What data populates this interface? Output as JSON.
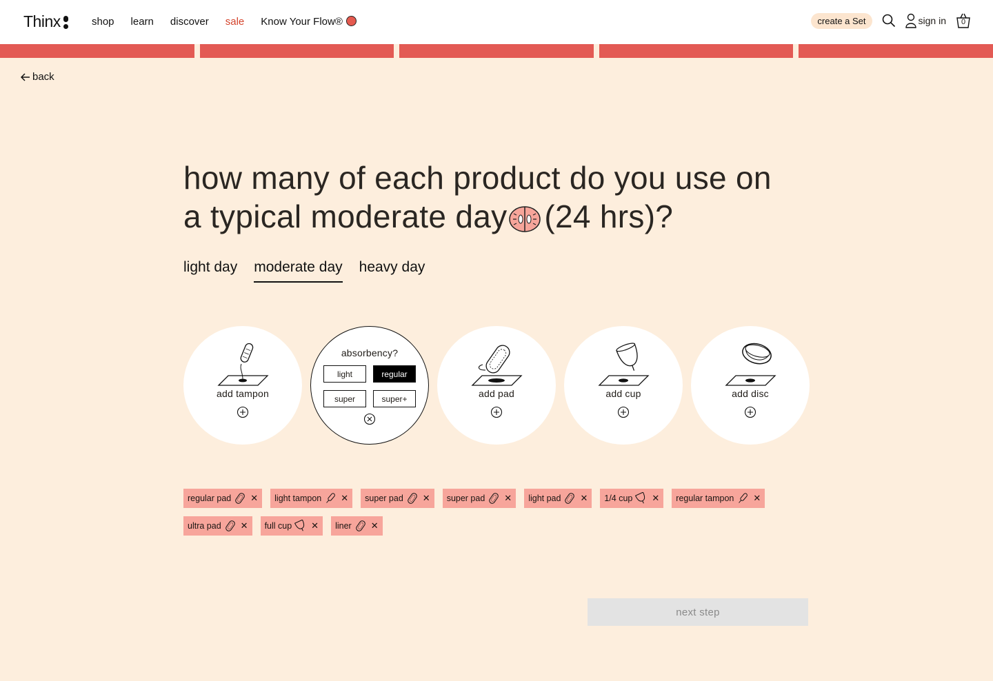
{
  "header": {
    "brand": "Thinx",
    "nav": [
      "shop",
      "learn",
      "discover",
      "sale",
      "Know Your Flow®"
    ],
    "create_set": "create a Set",
    "sign_in": "sign in",
    "cart_count": "0"
  },
  "progress": {
    "steps": 5
  },
  "back_label": "back",
  "question": {
    "line1": "how many of each product do you use on",
    "line2_a": "a typical moderate day",
    "line2_b": "(24 hrs)?"
  },
  "tabs": [
    {
      "label": "light day",
      "active": false
    },
    {
      "label": "moderate day",
      "active": true
    },
    {
      "label": "heavy day",
      "active": false
    }
  ],
  "products": [
    {
      "label": "add tampon",
      "icon": "tampon-icon"
    },
    {
      "label": "absorbency?",
      "options": [
        "light",
        "regular",
        "super",
        "super+"
      ],
      "selected": "regular"
    },
    {
      "label": "add pad",
      "icon": "pad-icon"
    },
    {
      "label": "add cup",
      "icon": "cup-icon"
    },
    {
      "label": "add disc",
      "icon": "disc-icon"
    }
  ],
  "chips": [
    {
      "label": "regular pad",
      "icon": "pad-icon"
    },
    {
      "label": "light tampon",
      "icon": "tampon-icon"
    },
    {
      "label": "super pad",
      "icon": "pad-icon"
    },
    {
      "label": "super pad",
      "icon": "pad-icon"
    },
    {
      "label": "light pad",
      "icon": "pad-icon"
    },
    {
      "label": "1/4 cup",
      "icon": "cup-icon"
    },
    {
      "label": "regular tampon",
      "icon": "tampon-icon"
    },
    {
      "label": "ultra pad",
      "icon": "pad-icon"
    },
    {
      "label": "full cup",
      "icon": "cup-icon"
    },
    {
      "label": "liner",
      "icon": "pad-icon"
    }
  ],
  "next_step": "next step",
  "colors": {
    "background": "#fdeedd",
    "accent": "#e35a54",
    "chip": "#f7a59b",
    "sale": "#d4432b"
  }
}
